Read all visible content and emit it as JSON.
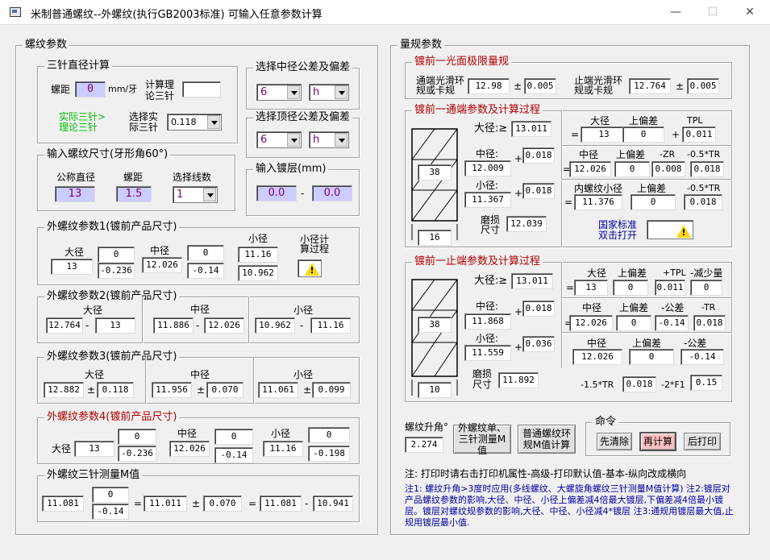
{
  "window": {
    "title": "米制普通螺纹--外螺纹(执行GB2003标准)  可输入任意参数计算",
    "min": "—",
    "max": "☐",
    "close": "✕"
  },
  "left": {
    "title": "螺纹参数",
    "three": {
      "title": "三针直径计算",
      "pitch_label": "螺距",
      "pitch": "0",
      "unit": "mm/牙",
      "theory_label1": "计算理",
      "theory_label2": "论三针",
      "theory_val": "",
      "note1": "实际三针>",
      "note2": "理论三针",
      "actual_label1": "选择实",
      "actual_label2": "际三针",
      "actual_sel": "0.118"
    },
    "mid_tol": {
      "title": "选择中径公差及偏差",
      "a": "6",
      "b": "h"
    },
    "top_tol": {
      "title": "选择顶径公差及偏差",
      "a": "6",
      "b": "h"
    },
    "size": {
      "title": "输入螺纹尺寸(牙形角60°)",
      "d_label": "公称直径",
      "p_label": "螺距",
      "n_label": "选择线数",
      "d": "13",
      "p": "1.5",
      "n": "1"
    },
    "plate": {
      "title": "输入镀层(mm)",
      "a": "0.0",
      "dash": "-",
      "b": "0.0"
    },
    "p1": {
      "title": "外螺纹参数1(镀前产品尺寸)",
      "maj_label": "大径",
      "maj": "13",
      "maj_up": "0",
      "maj_lo": "-0.236",
      "mid_label": "中径",
      "mid": "12.026",
      "mid_up": "0",
      "mid_lo": "-0.14",
      "min_label": "小径",
      "min_up": "11.16",
      "min": "10.962",
      "calc1": "小径计",
      "calc2": "算过程"
    },
    "p2": {
      "title": "外螺纹参数2(镀前产品尺寸)",
      "maj_label": "大径",
      "a1": "12.764",
      "a2": "13",
      "mid_label": "中径",
      "b1": "11.886",
      "b2": "12.026",
      "min_label": "小径",
      "c1": "10.962",
      "c2": "11.16",
      "dash": "-"
    },
    "p3": {
      "title": "外螺纹参数3(镀前产品尺寸)",
      "maj_label": "大径",
      "a1": "12.882",
      "a2": "0.118",
      "mid_label": "中径",
      "b1": "11.956",
      "b2": "0.070",
      "min_label": "小径",
      "c1": "11.061",
      "c2": "0.099",
      "pm": "±"
    },
    "p4": {
      "title": "外螺纹参数4(镀前产品尺寸)",
      "maj_label": "大径",
      "maj": "13",
      "maj_up": "0",
      "maj_lo": "-0.236",
      "mid_label": "中径",
      "mid": "12.026",
      "mid_up": "0",
      "mid_lo": "-0.14",
      "min_label": "小径",
      "min": "11.16",
      "min_up": "0",
      "min_lo": "-0.198"
    },
    "m": {
      "title": "外螺纹三针测量M值",
      "a": "11.081",
      "a_up": "0",
      "a_lo": "-0.14",
      "eq": "=",
      "b": "11.011",
      "pm": "±",
      "c": "0.070",
      "d": "11.081",
      "dash": "-",
      "e": "10.941"
    }
  },
  "right": {
    "title": "量规参数",
    "smooth": {
      "title": "镀前一光面极限量规",
      "go1": "通端光滑环",
      "go2": "规或卡规",
      "go_v": "12.98",
      "pm": "±",
      "go_t": "0.005",
      "ng1": "止端光滑环",
      "ng2": "规或卡规",
      "ng_v": "12.764",
      "ng_t": "0.005"
    },
    "go": {
      "title": "镀前一通端参数及计算过程",
      "w1": "38",
      "w2": "16",
      "maj_label": "大径:≥",
      "maj": "13.011",
      "mid_label": "中径:",
      "mid": "12.009",
      "mid_p": "0.018",
      "min_label": "小径:",
      "min": "11.367",
      "min_p": "0.018",
      "wear1": "磨损",
      "wear2": "尺寸",
      "wear": "12.039",
      "plus": "+",
      "r1": {
        "h1": "大径",
        "h2": "上偏差",
        "h3": "TPL",
        "v1": "13",
        "v2": "0",
        "v3": "0.011"
      },
      "r2": {
        "h1": "中径",
        "h2": "上偏差",
        "h3": "-ZR",
        "h4": "-0.5*TR",
        "v1": "12.026",
        "v2": "0",
        "v3": "0.008",
        "v4": "0.018"
      },
      "r3": {
        "h1": "内螺纹小径",
        "h2": "上偏差",
        "h3": "-0.5*TR",
        "v1": "11.376",
        "v2": "0",
        "v3": "0.018"
      },
      "std1": "国家标准",
      "std2": "双击打开",
      "eq": "="
    },
    "nogo": {
      "title": "镀前一止端参数及计算过程",
      "w1": "38",
      "w2": "10",
      "maj_label": "大径:≥",
      "maj": "13.011",
      "mid_label": "中径:",
      "mid": "11.868",
      "mid_p": "0.018",
      "min_label": "小径:",
      "min": "11.559",
      "min_p": "0.036",
      "wear1": "磨损",
      "wear2": "尺寸",
      "wear": "11.892",
      "plus": "+",
      "r1": {
        "h1": "大径",
        "h2": "上偏差",
        "h3": "+TPL",
        "h4": "-减少量",
        "v1": "13",
        "v2": "0",
        "v3": "0.011",
        "v4": "0"
      },
      "r2": {
        "h1": "中径",
        "h2": "上偏差",
        "h3": "-公差",
        "h4": "-TR",
        "v1": "12.026",
        "v2": "0",
        "v3": "-0.14",
        "v4": "0.018"
      },
      "r3": {
        "h1": "中径",
        "h2": "上偏差",
        "h3": "-公差",
        "v1": "12.026",
        "v2": "0",
        "v3": "-0.14"
      },
      "tr_label": "-1.5*TR",
      "tr": "0.018",
      "f1_label": "-2*F1",
      "f1": "0.15",
      "eq": "="
    },
    "lift_label": "螺纹升角°",
    "lift": "2.274",
    "btn_ext1": "外螺纹单、",
    "btn_ext2": "三针测量M值",
    "btn_ring1": "普通螺纹环",
    "btn_ring2": "规M值计算",
    "cmd": {
      "title": "命令",
      "clear": "先清除",
      "recalc": "再计算",
      "print": "后打印"
    },
    "note_print": "注: 打印时请右击打印机属性-高级-打印默认值-基本-纵向改成横向",
    "note_long": "注1: 螺纹升角>3度时应用(多线螺纹、大螺旋角螺纹三针测量M值计算) 注2:镀层对产品螺纹参数的影响,大径、中径、小径上偏差减4倍最大镀层,下偏差减4倍最小镀层。镀层对螺纹规参数的影响,大径、中径、小径减4*镀层 注3:通规用镀层最大值,止规用镀层最小值."
  }
}
